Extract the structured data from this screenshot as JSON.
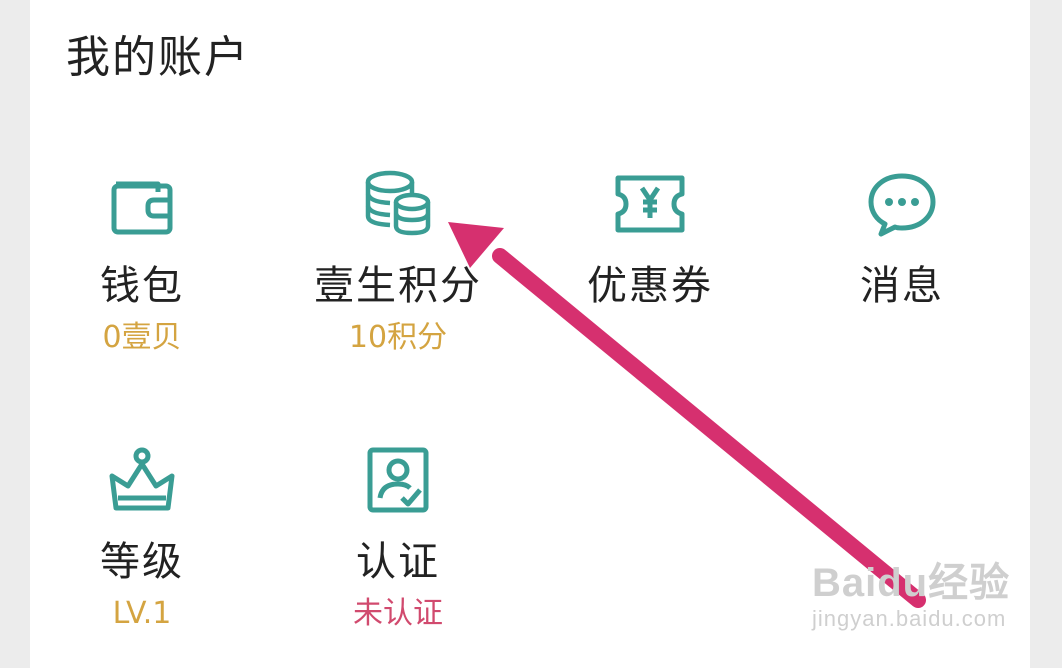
{
  "section": {
    "title": "我的账户"
  },
  "items": [
    {
      "label": "钱包",
      "sub": "0壹贝",
      "icon": "wallet-icon"
    },
    {
      "label": "壹生积分",
      "sub": "10积分",
      "icon": "coins-icon"
    },
    {
      "label": "优惠券",
      "sub": "",
      "icon": "coupon-icon"
    },
    {
      "label": "消息",
      "sub": "",
      "icon": "message-icon"
    },
    {
      "label": "等级",
      "sub": "LV.1",
      "icon": "crown-icon"
    },
    {
      "label": "认证",
      "sub": "未认证",
      "icon": "id-card-icon"
    }
  ],
  "colors": {
    "icon": "#3a9d94",
    "sub_gold": "#d4a441",
    "sub_red": "#d14a6e",
    "arrow": "#d6306f"
  },
  "watermark": {
    "brand": "Baidu经验",
    "url": "jingyan.baidu.com"
  }
}
